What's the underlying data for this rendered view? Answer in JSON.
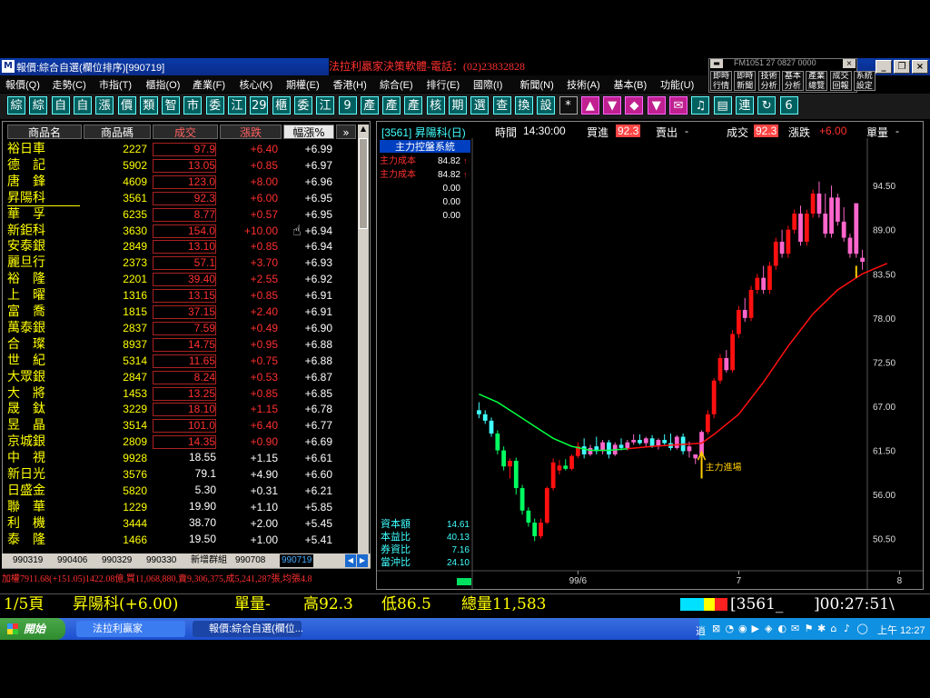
{
  "window": {
    "title": "報價:綜合自選(欄位排序)[990719]",
    "ad_text": "法拉利贏家決策軟體-電話：(02)23832828",
    "mini_caption": "FM1051 27 0827 0000"
  },
  "menu": [
    "報價(Q)",
    "走勢(C)",
    "市指(T)",
    "櫃指(O)",
    "產業(F)",
    "核心(K)",
    "期權(E)",
    "香港(H)",
    "綜合(E)",
    "排行(E)",
    "國際(I)",
    "新聞(N)",
    "技術(A)",
    "基本(B)",
    "功能(U)"
  ],
  "sys_buttons": [
    "即時行情",
    "即時新聞",
    "技術分析",
    "基本分析",
    "產業總覽",
    "成交回報",
    "系統設定"
  ],
  "toolbar": [
    "綜",
    "綜",
    "自",
    "自",
    "漲",
    "價",
    "類",
    "智",
    "市",
    "委",
    "江",
    "29",
    "櫃",
    "委",
    "江",
    "9",
    "產",
    "產",
    "產",
    "核",
    "期",
    "選",
    "查",
    "換",
    "設",
    "*",
    "▲",
    "▼",
    "◆",
    "▼",
    "✉",
    "♫",
    "▤",
    "連",
    "↻",
    "6"
  ],
  "list": {
    "headers": [
      "商品名",
      "商品碼",
      "成交",
      "漲跌",
      "幅漲%"
    ],
    "rows": [
      {
        "name": "裕日車",
        "code": "2227",
        "price": "97.9",
        "change": "+6.40",
        "pct": "+6.99",
        "boxed": true
      },
      {
        "name": "德　記",
        "code": "5902",
        "price": "13.05",
        "change": "+0.85",
        "pct": "+6.97",
        "boxed": true
      },
      {
        "name": "唐　鋒",
        "code": "4609",
        "price": "123.0",
        "change": "+8.00",
        "pct": "+6.96",
        "boxed": true
      },
      {
        "name": "昇陽科",
        "code": "3561",
        "price": "92.3",
        "change": "+6.00",
        "pct": "+6.95",
        "boxed": true
      },
      {
        "name": "華　孚",
        "code": "6235",
        "price": "8.77",
        "change": "+0.57",
        "pct": "+6.95",
        "boxed": true
      },
      {
        "name": "新鉅科",
        "code": "3630",
        "price": "154.0",
        "change": "+10.00",
        "pct": "+6.94",
        "boxed": true
      },
      {
        "name": "安泰銀",
        "code": "2849",
        "price": "13.10",
        "change": "+0.85",
        "pct": "+6.94",
        "boxed": true
      },
      {
        "name": "麗旦行",
        "code": "2373",
        "price": "57.1",
        "change": "+3.70",
        "pct": "+6.93",
        "boxed": true
      },
      {
        "name": "裕　隆",
        "code": "2201",
        "price": "39.40",
        "change": "+2.55",
        "pct": "+6.92",
        "boxed": true
      },
      {
        "name": "上　曜",
        "code": "1316",
        "price": "13.15",
        "change": "+0.85",
        "pct": "+6.91",
        "boxed": true
      },
      {
        "name": "富　喬",
        "code": "1815",
        "price": "37.15",
        "change": "+2.40",
        "pct": "+6.91",
        "boxed": true
      },
      {
        "name": "萬泰銀",
        "code": "2837",
        "price": "7.59",
        "change": "+0.49",
        "pct": "+6.90",
        "boxed": true
      },
      {
        "name": "合　璨",
        "code": "8937",
        "price": "14.75",
        "change": "+0.95",
        "pct": "+6.88",
        "boxed": true
      },
      {
        "name": "世　紀",
        "code": "5314",
        "price": "11.65",
        "change": "+0.75",
        "pct": "+6.88",
        "boxed": true
      },
      {
        "name": "大眾銀",
        "code": "2847",
        "price": "8.24",
        "change": "+0.53",
        "pct": "+6.87",
        "boxed": true
      },
      {
        "name": "大　將",
        "code": "1453",
        "price": "13.25",
        "change": "+0.85",
        "pct": "+6.85",
        "boxed": true
      },
      {
        "name": "晟　鈦",
        "code": "3229",
        "price": "18.10",
        "change": "+1.15",
        "pct": "+6.78",
        "boxed": true
      },
      {
        "name": "昱　晶",
        "code": "3514",
        "price": "101.0",
        "change": "+6.40",
        "pct": "+6.77",
        "boxed": true
      },
      {
        "name": "京城銀",
        "code": "2809",
        "price": "14.35",
        "change": "+0.90",
        "pct": "+6.69",
        "boxed": true
      },
      {
        "name": "中　視",
        "code": "9928",
        "price": "18.55",
        "change": "+1.15",
        "pct": "+6.61",
        "boxed": false
      },
      {
        "name": "新日光",
        "code": "3576",
        "price": "79.1",
        "change": "+4.90",
        "pct": "+6.60",
        "boxed": false
      },
      {
        "name": "日盛金",
        "code": "5820",
        "price": "5.30",
        "change": "+0.31",
        "pct": "+6.21",
        "boxed": false
      },
      {
        "name": "聯　華",
        "code": "1229",
        "price": "19.90",
        "change": "+1.10",
        "pct": "+5.85",
        "boxed": false
      },
      {
        "name": "利　機",
        "code": "3444",
        "price": "38.70",
        "change": "+2.00",
        "pct": "+5.45",
        "boxed": false
      },
      {
        "name": "泰　隆",
        "code": "1466",
        "price": "19.50",
        "change": "+1.00",
        "pct": "+5.41",
        "boxed": false
      }
    ]
  },
  "tabs": [
    "990319",
    "990406",
    "990329",
    "990330",
    "新增群組",
    "990708",
    "990719"
  ],
  "ticker": "加權7911.68(+151.05)1422.08億,買11,068,880,賣9,306,375,成5,241,287張,均張4.8",
  "chart": {
    "head": {
      "code": "[3561] 昇陽科(日)",
      "time_label": "時間",
      "time": "14:30:00",
      "bid_label": "買進",
      "bid": "92.3",
      "ask_label": "賣出",
      "ask": "-",
      "deal_label": "成交",
      "deal": "92.3",
      "chg_label": "漲跌",
      "chg": "+6.00",
      "vol_label": "單量",
      "vol": "-"
    },
    "system_title": "主力控盤系統",
    "legend": [
      {
        "label": "主力成本",
        "value": "84.82",
        "color": "#ff3030"
      },
      {
        "label": "主力成本",
        "value": "84.82",
        "color": "#ff3030"
      },
      {
        "label": "",
        "value": "0.00",
        "color": "#ffffff"
      },
      {
        "label": "",
        "value": "0.00",
        "color": "#ffffff"
      },
      {
        "label": "",
        "value": "0.00",
        "color": "#ffffff"
      }
    ],
    "stats": [
      {
        "label": "資本額",
        "value": "14.61"
      },
      {
        "label": "本益比",
        "value": "40.13"
      },
      {
        "label": "券資比",
        "value": "7.16"
      },
      {
        "label": "當沖比",
        "value": "24.10"
      }
    ],
    "annotation": "主力進場",
    "x_labels": [
      {
        "text": "99/6",
        "i": 16
      },
      {
        "text": "7",
        "i": 42
      },
      {
        "text": "8",
        "i": 68
      }
    ]
  },
  "chart_data": {
    "type": "candlestick",
    "ylim": [
      46.5,
      99.5
    ],
    "yticks": [
      94.5,
      89.0,
      83.5,
      78.0,
      72.5,
      67.0,
      61.5,
      56.0,
      50.5
    ],
    "candles": [
      [
        66.5,
        67.5,
        65.5,
        66.0
      ],
      [
        66.0,
        66.5,
        64.8,
        65.2
      ],
      [
        65.2,
        65.6,
        63.2,
        63.6
      ],
      [
        63.6,
        64.0,
        61.0,
        61.5
      ],
      [
        61.5,
        62.0,
        59.0,
        59.5
      ],
      [
        59.5,
        60.5,
        58.0,
        60.2
      ],
      [
        60.2,
        60.6,
        56.0,
        56.8
      ],
      [
        56.8,
        57.2,
        53.5,
        54.0
      ],
      [
        54.0,
        54.4,
        52.0,
        52.5
      ],
      [
        52.5,
        53.0,
        50.2,
        50.8
      ],
      [
        50.8,
        53.0,
        50.5,
        52.5
      ],
      [
        52.5,
        57.0,
        52.3,
        56.8
      ],
      [
        56.8,
        60.5,
        56.5,
        60.0
      ],
      [
        59.0,
        60.3,
        58.5,
        59.6
      ],
      [
        59.6,
        60.4,
        59.0,
        59.2
      ],
      [
        59.2,
        61.0,
        59.0,
        60.8
      ],
      [
        60.8,
        62.5,
        60.5,
        62.0
      ],
      [
        62.0,
        63.0,
        60.5,
        61.0
      ],
      [
        61.0,
        62.2,
        60.8,
        61.8
      ],
      [
        62.0,
        63.2,
        61.0,
        61.4
      ],
      [
        61.4,
        62.8,
        61.0,
        62.5
      ],
      [
        62.5,
        62.8,
        60.5,
        61.0
      ],
      [
        61.0,
        62.5,
        60.8,
        62.2
      ],
      [
        62.2,
        63.0,
        61.5,
        61.8
      ],
      [
        61.8,
        62.8,
        61.5,
        62.5
      ],
      [
        62.5,
        63.5,
        62.2,
        62.8
      ],
      [
        62.8,
        63.5,
        62.2,
        62.4
      ],
      [
        62.4,
        63.2,
        62.0,
        63.0
      ],
      [
        63.0,
        63.4,
        61.8,
        62.0
      ],
      [
        62.0,
        63.0,
        61.6,
        62.8
      ],
      [
        62.8,
        63.5,
        62.2,
        62.4
      ],
      [
        62.4,
        63.6,
        61.5,
        61.8
      ],
      [
        61.8,
        63.4,
        61.6,
        63.2
      ],
      [
        63.2,
        63.6,
        61.0,
        61.4
      ],
      [
        61.4,
        62.6,
        60.6,
        62.0
      ],
      [
        60.5,
        61.0,
        59.8,
        61.0
      ],
      [
        61.0,
        64.0,
        60.8,
        63.8
      ],
      [
        63.8,
        66.5,
        63.5,
        66.0
      ],
      [
        66.0,
        70.5,
        65.5,
        70.2
      ],
      [
        70.2,
        73.5,
        69.8,
        73.0
      ],
      [
        73.0,
        74.0,
        71.2,
        71.5
      ],
      [
        71.5,
        76.5,
        71.2,
        76.0
      ],
      [
        76.0,
        79.5,
        75.5,
        79.0
      ],
      [
        79.0,
        80.5,
        77.5,
        78.0
      ],
      [
        78.0,
        82.0,
        77.6,
        81.5
      ],
      [
        81.5,
        83.5,
        81.0,
        83.0
      ],
      [
        83.0,
        84.5,
        81.0,
        81.5
      ],
      [
        81.5,
        85.0,
        81.0,
        84.5
      ],
      [
        84.5,
        88.0,
        84.0,
        87.5
      ],
      [
        87.5,
        89.0,
        85.5,
        86.0
      ],
      [
        86.0,
        89.5,
        85.5,
        89.0
      ],
      [
        89.0,
        91.5,
        88.5,
        91.0
      ],
      [
        91.0,
        92.0,
        87.0,
        87.5
      ],
      [
        87.5,
        91.5,
        87.0,
        91.0
      ],
      [
        91.0,
        94.0,
        90.5,
        93.5
      ],
      [
        93.5,
        95.0,
        90.5,
        91.0
      ],
      [
        91.0,
        93.5,
        88.0,
        88.5
      ],
      [
        88.5,
        94.5,
        88.0,
        93.0
      ],
      [
        93.0,
        93.5,
        89.5,
        90.0
      ],
      [
        90.0,
        91.8,
        87.5,
        88.0
      ],
      [
        88.0,
        88.5,
        85.5,
        86.0
      ],
      [
        86.0,
        92.0,
        85.5,
        92.3
      ],
      [
        85.0,
        86.5,
        84.0,
        85.5
      ]
    ],
    "candle_up_color": "#ff1010",
    "candle_down_color": "#00ff60",
    "candle_last_color": "#ff66cc",
    "ma_green": [
      [
        0,
        68.5
      ],
      [
        3,
        67.5
      ],
      [
        6,
        66.0
      ],
      [
        9,
        64.5
      ],
      [
        12,
        63.0
      ],
      [
        15,
        62.0
      ],
      [
        18,
        61.5
      ],
      [
        21,
        61.5
      ],
      [
        24,
        61.7
      ]
    ],
    "ma_red": [
      [
        24,
        61.7
      ],
      [
        28,
        62.0
      ],
      [
        32,
        62.2
      ],
      [
        36,
        62.4
      ],
      [
        38,
        63.5
      ],
      [
        42,
        66.0
      ],
      [
        46,
        70.0
      ],
      [
        50,
        74.5
      ],
      [
        54,
        78.5
      ],
      [
        58,
        81.5
      ],
      [
        62,
        83.5
      ],
      [
        66,
        84.8
      ]
    ]
  },
  "status": {
    "page": "1/5頁",
    "name": "昇陽科(+6.00)",
    "vol": "單量-",
    "high": "高92.3",
    "low": "低86.5",
    "total": "總量11,583",
    "code": "[3561_",
    "clock": "]00:27:51\\"
  },
  "taskbar": {
    "start": "開始",
    "tasks": [
      "法拉利贏家",
      "報價:綜合自選(欄位..."
    ],
    "clock": "上午 12:27",
    "ime": "逍"
  }
}
